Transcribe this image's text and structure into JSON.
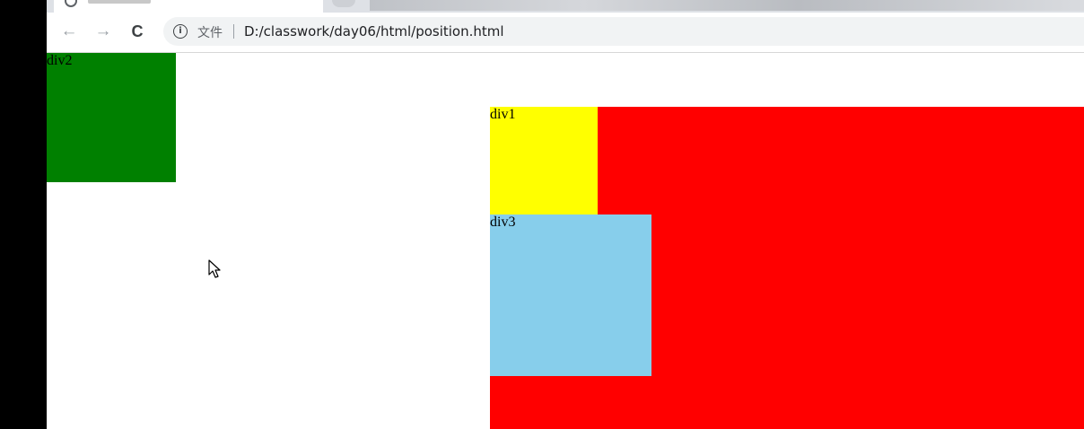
{
  "browser": {
    "tab": {
      "close_glyph": "×"
    },
    "toolbar": {
      "back_icon": "←",
      "forward_icon": "→",
      "reload_icon": "C",
      "info_icon": "i",
      "scheme_label": "文件",
      "url": "D:/classwork/day06/html/position.html"
    }
  },
  "page": {
    "div2": {
      "label": "div2",
      "color": "#008000"
    },
    "container": {
      "color": "#ff0000"
    },
    "div1": {
      "label": "div1",
      "color": "#ffff00"
    },
    "div3": {
      "label": "div3",
      "color": "#87ceeb"
    }
  }
}
